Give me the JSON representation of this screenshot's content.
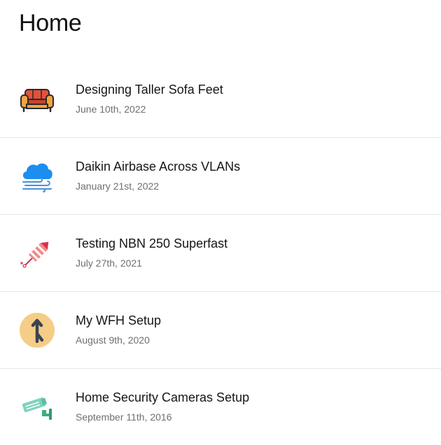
{
  "page": {
    "title": "Home"
  },
  "posts": [
    {
      "title": "Designing Taller Sofa Feet",
      "date": "June 10th, 2022",
      "icon": "sofa-icon"
    },
    {
      "title": "Daikin Airbase Across VLANs",
      "date": "January 21st, 2022",
      "icon": "cloud-wind-icon"
    },
    {
      "title": "Testing NBN 250 Superfast",
      "date": "July 27th, 2021",
      "icon": "firework-rocket-icon"
    },
    {
      "title": "My WFH Setup",
      "date": "August 9th, 2020",
      "icon": "merge-arrow-icon"
    },
    {
      "title": "Home Security Cameras Setup",
      "date": "September 11th, 2016",
      "icon": "security-camera-icon"
    }
  ]
}
